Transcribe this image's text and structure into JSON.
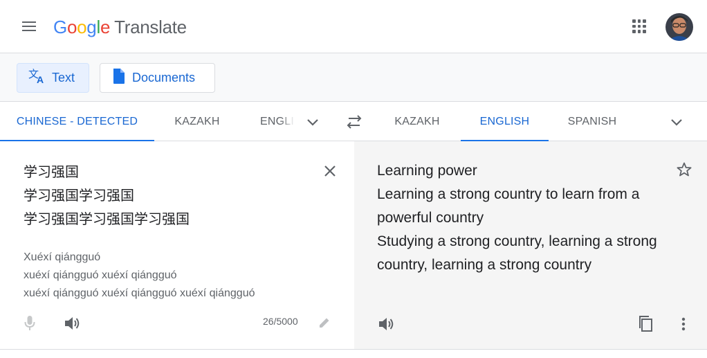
{
  "header": {
    "logo": {
      "g1": "G",
      "o1": "o",
      "o2": "o",
      "g2": "g",
      "l": "l",
      "e": "e"
    },
    "product_name": "Translate",
    "icons": {
      "menu": "menu-icon",
      "apps": "apps-grid-icon",
      "avatar": "account-avatar"
    }
  },
  "modes": {
    "text_label": "Text",
    "documents_label": "Documents",
    "active": "Text"
  },
  "source_languages": [
    {
      "label": "CHINESE - DETECTED",
      "active": true
    },
    {
      "label": "KAZAKH",
      "active": false
    },
    {
      "label": "ENGLISH",
      "active": false
    }
  ],
  "target_languages": [
    {
      "label": "KAZAKH",
      "active": false
    },
    {
      "label": "ENGLISH",
      "active": true
    },
    {
      "label": "SPANISH",
      "active": false
    }
  ],
  "source": {
    "lines": [
      "学习强国",
      "学习强国学习强国",
      "学习强国学习强国学习强国"
    ],
    "transliteration": [
      "Xuéxí qiángguó",
      "xuéxí qiángguó xuéxí qiángguó",
      "xuéxí qiángguó xuéxí qiángguó xuéxí qiángguó"
    ],
    "char_count": "26/5000"
  },
  "target": {
    "lines": [
      "Learning power",
      "Learning a strong country to learn from a powerful country",
      "Studying a strong country, learning a strong country, learning a strong country"
    ]
  },
  "colors": {
    "accent": "#1a73e8",
    "accent_text": "#1967d2",
    "icon_gray": "#5f6368",
    "target_bg": "#f5f5f5"
  }
}
